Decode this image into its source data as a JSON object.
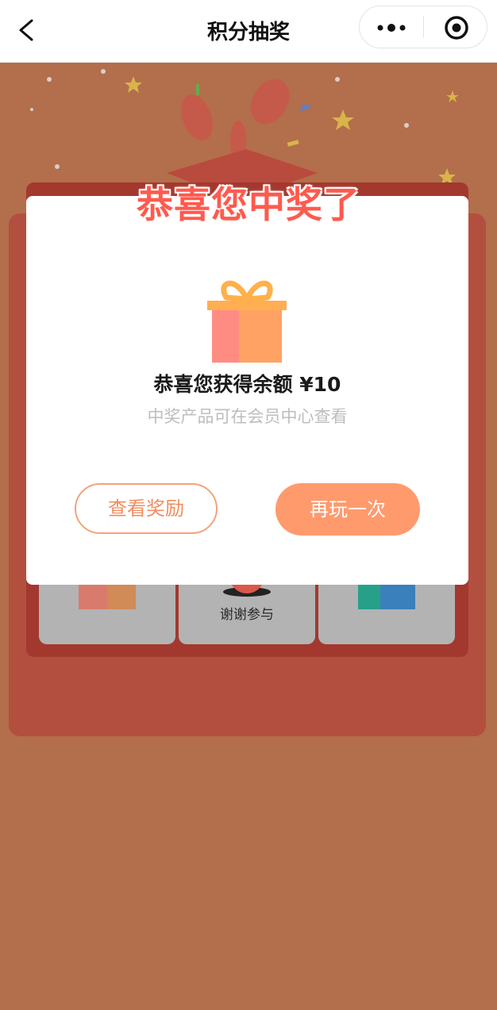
{
  "navbar": {
    "title": "积分抽奖",
    "back_icon": "chevron-left-icon",
    "more_icon": "more-dots-icon",
    "target_icon": "circle-target-icon"
  },
  "modal": {
    "headline": "恭喜您中奖了",
    "prize_text": "恭喜您获得余额 ¥10",
    "prize_sub": "中奖产品可在会员中心查看",
    "view_button": "查看奖励",
    "again_button": "再玩一次"
  },
  "board": {
    "cells": [
      {
        "icon": "gift-icon",
        "label": ""
      },
      {
        "icon": "mascot-icon",
        "label": "谢谢参与"
      },
      {
        "icon": "gift-icon",
        "label": ""
      }
    ]
  },
  "colors": {
    "background": "#b36e4b",
    "accent": "#ff9a6c",
    "headline": "#ff5a4e"
  }
}
